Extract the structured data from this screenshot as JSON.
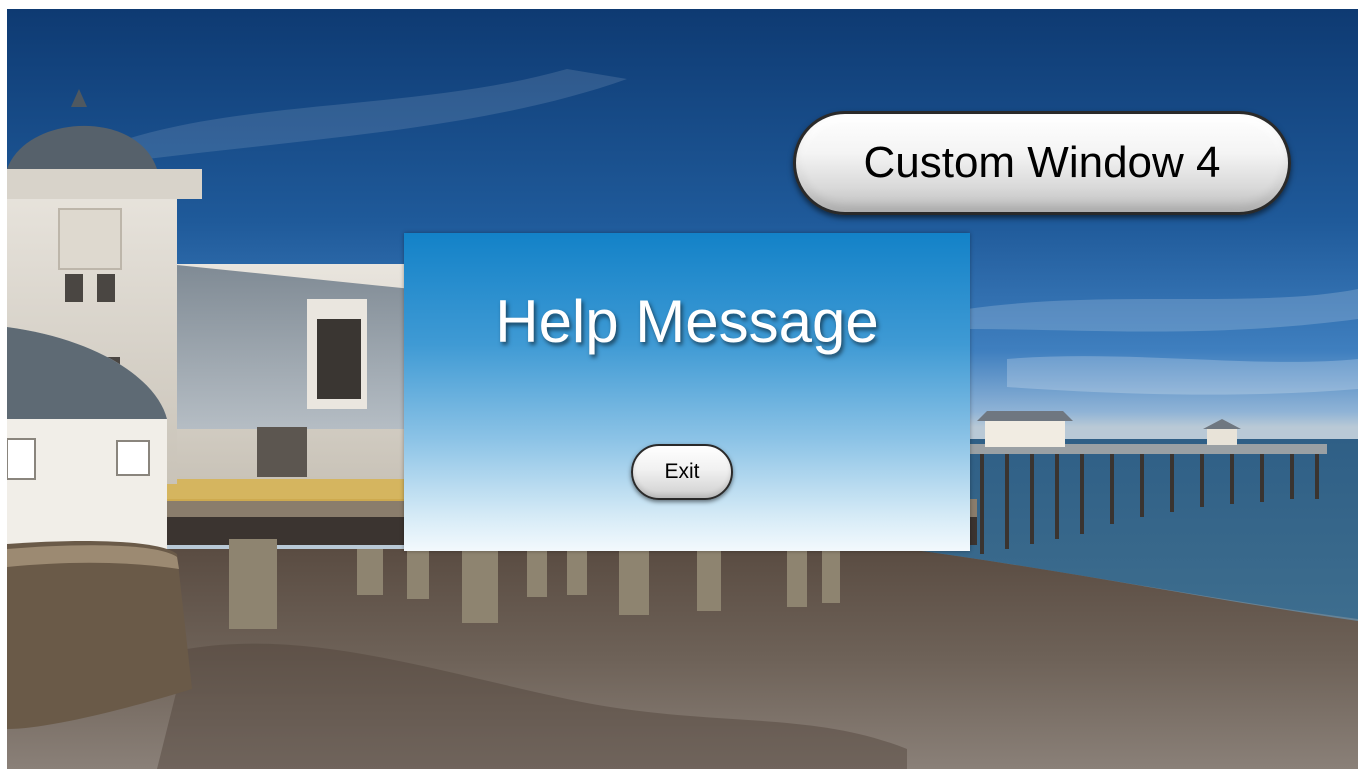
{
  "background": {
    "description_icon": "seaside-pier-photo"
  },
  "header_button": {
    "label": "Custom Window 4"
  },
  "help_window": {
    "title": "Help Message",
    "exit_label": "Exit",
    "gradient_top": "#1382c8",
    "gradient_bottom": "#f3f9fd"
  }
}
